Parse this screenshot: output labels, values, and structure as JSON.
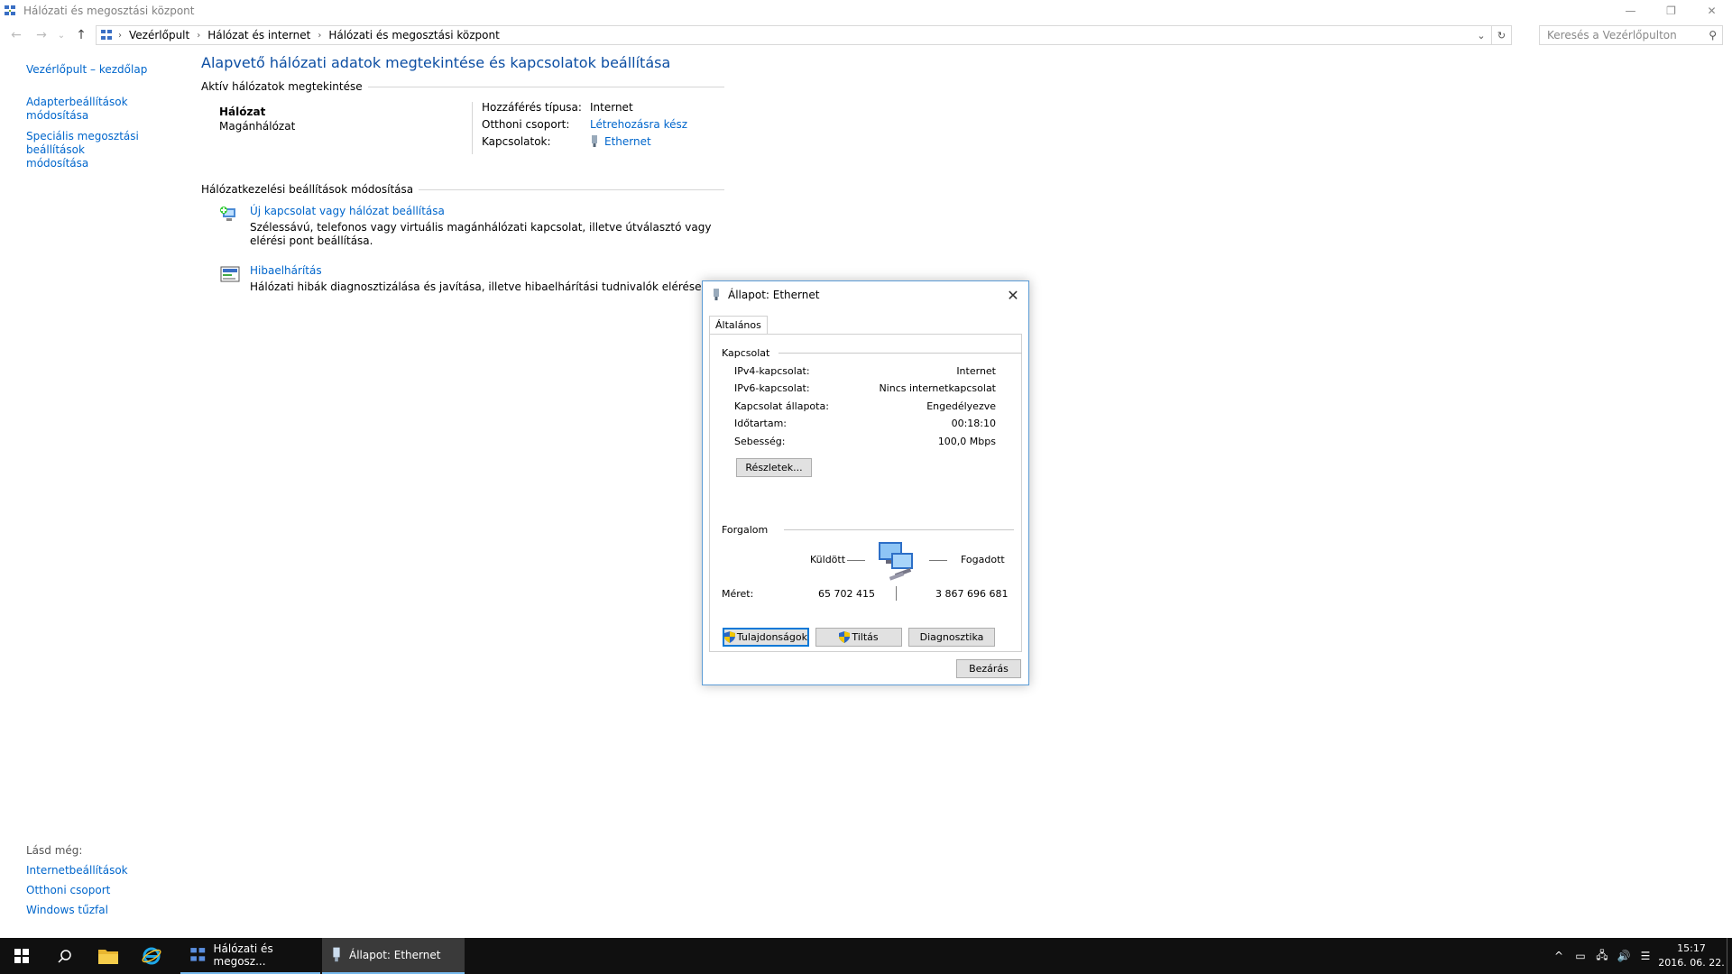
{
  "window": {
    "title": "Hálózati és megosztási központ",
    "controls": {
      "minimize": "—",
      "maximize": "❐",
      "close": "✕"
    }
  },
  "nav": {
    "back": "←",
    "forward": "→",
    "recent": "⌄",
    "up": "↑"
  },
  "address": {
    "crumbs": [
      "Vezérlőpult",
      "Hálózat és internet",
      "Hálózati és megosztási központ"
    ],
    "separator": "›",
    "dropdown": "⌄",
    "refresh": "↻"
  },
  "search": {
    "placeholder": "Keresés a Vezérlőpulton",
    "icon": "⚲"
  },
  "sidebar": {
    "items": [
      {
        "label": "Vezérlőpult – kezdőlap"
      },
      {
        "label": "Adapterbeállítások módosítása"
      },
      {
        "label": "Speciális megosztási beállítások módosítása"
      }
    ],
    "see_also": {
      "header": "Lásd még:",
      "links": [
        "Internetbeállítások",
        "Otthoni csoport",
        "Windows tűzfal"
      ]
    }
  },
  "main": {
    "title": "Alapvető hálózati adatok megtekintése és kapcsolatok beállítása",
    "active_header": "Aktív hálózatok megtekintése",
    "network": {
      "name": "Hálózat",
      "type": "Magánhálózat",
      "access_label": "Hozzáférés típusa:",
      "access_value": "Internet",
      "homegroup_label": "Otthoni csoport:",
      "homegroup_value": "Létrehozásra kész",
      "connections_label": "Kapcsolatok:",
      "connections_value": "Ethernet"
    },
    "settings_header": "Hálózatkezelési beállítások módosítása",
    "tasks": [
      {
        "title": "Új kapcsolat vagy hálózat beállítása",
        "desc": "Szélessávú, telefonos vagy virtuális magánhálózati kapcsolat, illetve útválasztó vagy elérési pont beállítása."
      },
      {
        "title": "Hibaelhárítás",
        "desc": "Hálózati hibák diagnosztizálása és javítása, illetve hibaelhárítási tudnivalók elérése."
      }
    ]
  },
  "dialog": {
    "title": "Állapot: Ethernet",
    "close": "✕",
    "tab": "Általános",
    "connection_header": "Kapcsolat",
    "rows": [
      {
        "label": "IPv4-kapcsolat:",
        "value": "Internet"
      },
      {
        "label": "IPv6-kapcsolat:",
        "value": "Nincs internetkapcsolat"
      },
      {
        "label": "Kapcsolat állapota:",
        "value": "Engedélyezve"
      },
      {
        "label": "Időtartam:",
        "value": "00:18:10"
      },
      {
        "label": "Sebesség:",
        "value": "100,0 Mbps"
      }
    ],
    "details_button": "Részletek...",
    "traffic_header": "Forgalom",
    "sent_label": "Küldött",
    "received_label": "Fogadott",
    "size_label": "Méret:",
    "sent_value": "65 702 415",
    "received_value": "3 867 696 681",
    "properties_button": "Tulajdonságok",
    "disable_button": "Tiltás",
    "diagnose_button": "Diagnosztika",
    "close_button": "Bezárás"
  },
  "taskbar": {
    "start_icon": "windows-logo",
    "tasks": [
      {
        "label": "Hálózati és megosz..."
      },
      {
        "label": "Állapot: Ethernet"
      }
    ],
    "tray": {
      "chevron": "^",
      "time": "15:17",
      "date": "2016. 06. 22."
    }
  },
  "colors": {
    "link": "#0066cc",
    "title": "#0c4ea3",
    "taskbar": "#101010",
    "accent": "#0078d7"
  }
}
